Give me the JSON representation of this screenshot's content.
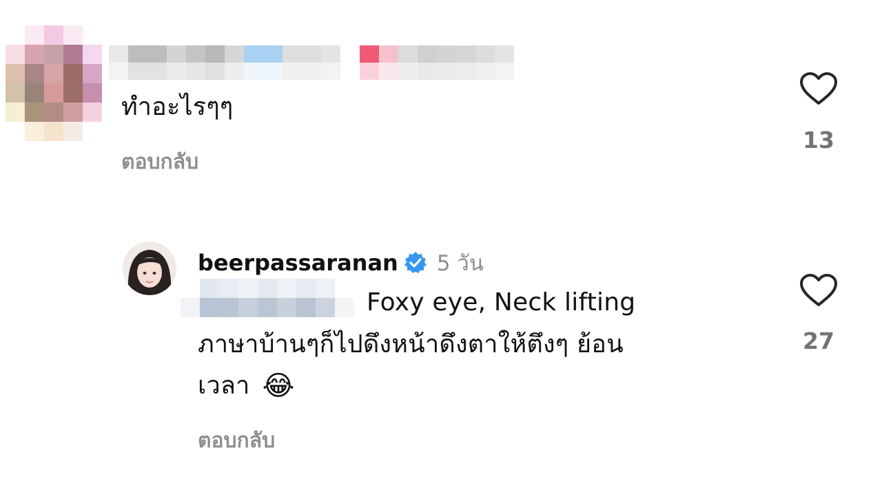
{
  "comments": [
    {
      "text": "ทำอะไรๆๆ",
      "reply_label": "ตอบกลับ",
      "likes": "13"
    },
    {
      "username": "beerpassaranan",
      "verified": true,
      "time": "5 วัน",
      "text_line1": "Foxy eye, Neck lifting",
      "text_line2": "ภาษาบ้านๆก็ไปดึงหน้าดึงตาให้ตึงๆ ย้อน",
      "text_line3": "เวลา",
      "emoji": "😂",
      "reply_label": "ตอบกลับ",
      "likes": "27"
    }
  ],
  "colors": {
    "verified_badge": "#3797f0",
    "secondary_text": "#8e8e8e",
    "like_count": "#737373"
  },
  "icons": [
    "heart-outline-icon",
    "verified-badge-icon",
    "face-with-tears-of-joy-emoji"
  ]
}
